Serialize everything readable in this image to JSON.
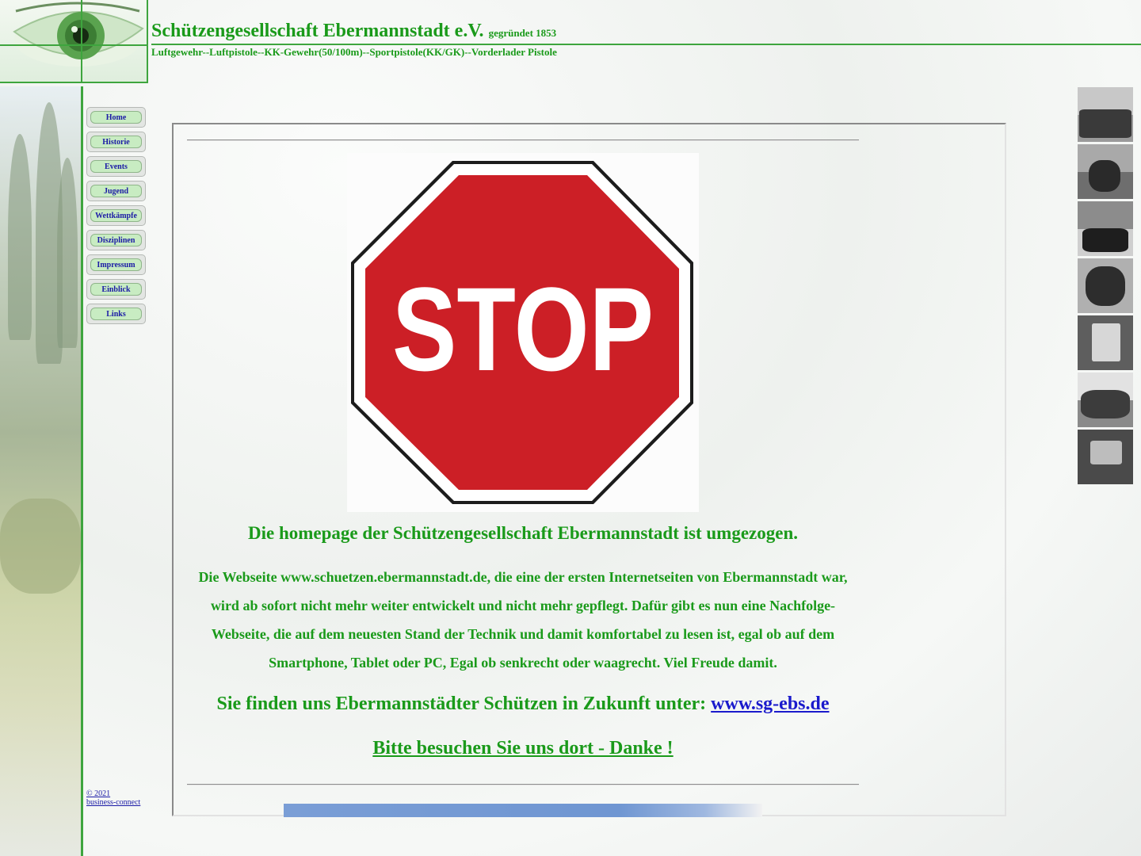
{
  "header": {
    "title": "Schützengesellschaft Ebermannstadt e.V.",
    "founded": "gegründet 1853",
    "subtitle": "Luftgewehr--Luftpistole--KK-Gewehr(50/100m)--Sportpistole(KK/GK)--Vorderlader Pistole"
  },
  "nav": {
    "items": [
      {
        "label": "Home"
      },
      {
        "label": "Historie"
      },
      {
        "label": "Events"
      },
      {
        "label": "Jugend"
      },
      {
        "label": "Wettkämpfe"
      },
      {
        "label": "Disziplinen"
      },
      {
        "label": "Impressum"
      },
      {
        "label": "Einblick"
      },
      {
        "label": "Links"
      }
    ]
  },
  "footer": {
    "copyright_year": "© 2021",
    "copyright_name": "business-connect"
  },
  "main": {
    "stop_sign_text": "STOP",
    "moved_heading": "Die homepage der Schützengesellschaft Ebermannstadt ist umgezogen.",
    "body_line1": "Die Webseite www.schuetzen.ebermannstadt.de, die eine der ersten Internetseiten von Ebermannstadt war,",
    "body_line2": "wird ab sofort nicht mehr weiter entwickelt und nicht mehr gepflegt. Dafür gibt es nun eine Nachfolge-",
    "body_line3": "Webseite, die auf dem neuesten Stand der Technik und damit komfortabel zu lesen ist, egal ob auf dem",
    "body_line4": "Smartphone, Tablet oder PC, Egal ob senkrecht oder waagrecht. Viel Freude damit.",
    "future_text": "Sie finden uns Ebermannstädter Schützen in Zukunft unter: ",
    "future_link": "www.sg-ebs.de",
    "visit_link": "Bitte besuchen Sie uns dort - Danke !"
  },
  "colors": {
    "brand_green": "#1a9a1a",
    "link_blue": "#1a1acc",
    "stop_red": "#cc1f26"
  },
  "thumbnails": [
    {
      "name": "historic-group-photo"
    },
    {
      "name": "parade-street-photo"
    },
    {
      "name": "marching-band-photo"
    },
    {
      "name": "shooters-photo"
    },
    {
      "name": "clubhouse-photo"
    },
    {
      "name": "crowd-photo"
    },
    {
      "name": "shooting-range-photo"
    }
  ]
}
